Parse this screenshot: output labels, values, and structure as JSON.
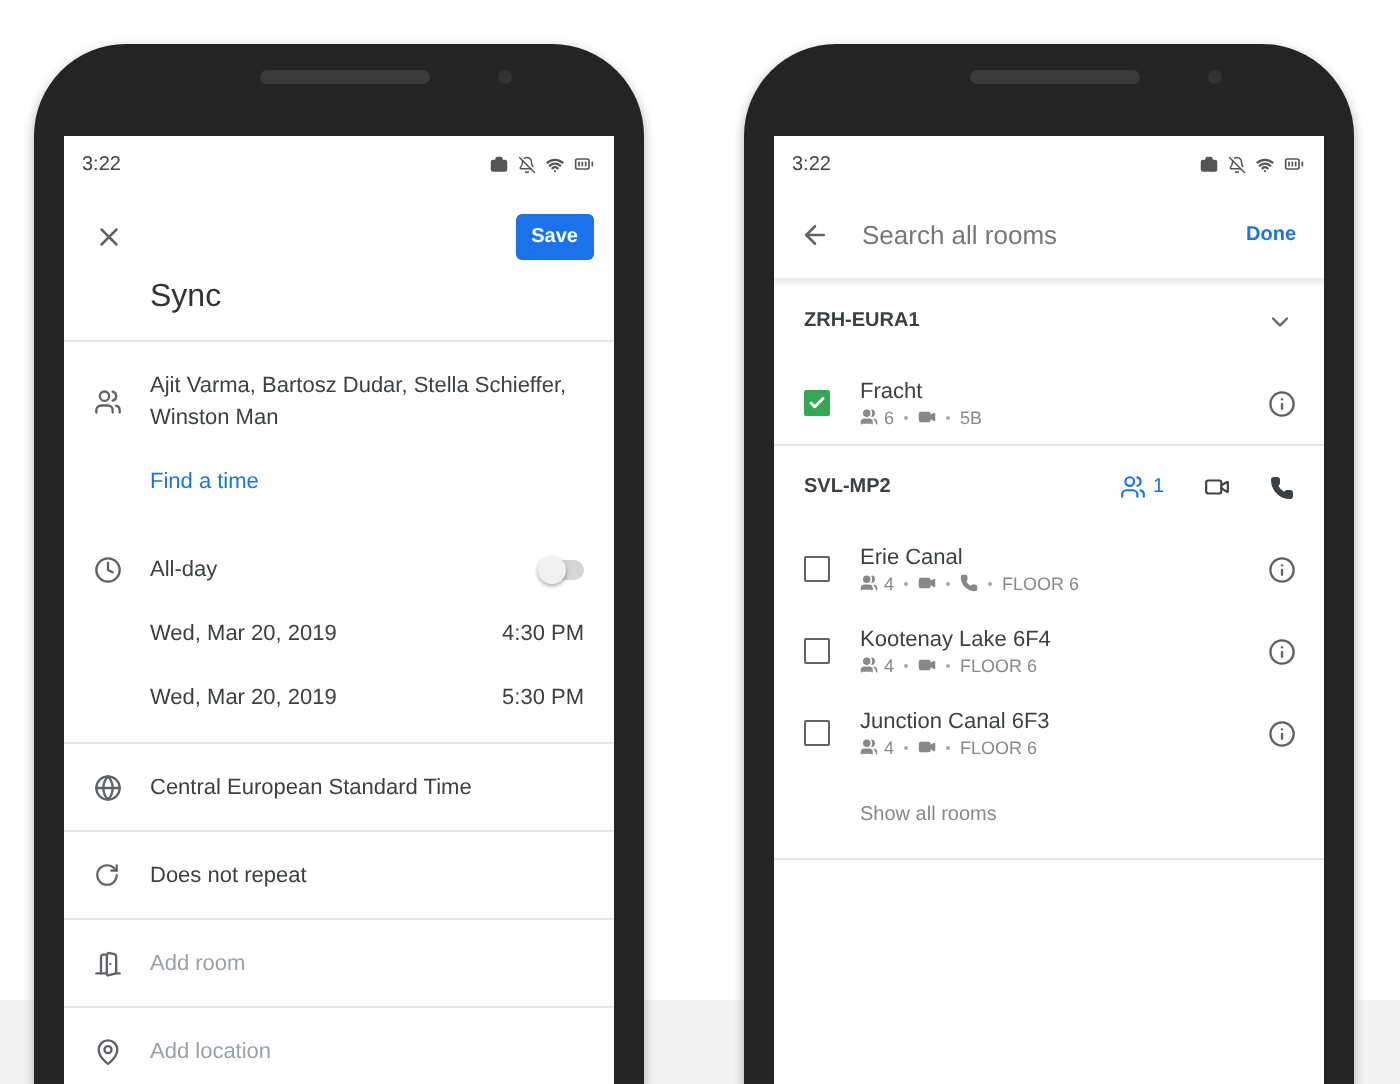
{
  "left_screen": {
    "status_time": "3:22",
    "save_label": "Save",
    "title": "Sync",
    "guests": "Ajit Varma, Bartosz Dudar, Stella Schieffer, Winston Man",
    "find_time": "Find a time",
    "all_day": {
      "label": "All-day",
      "on": false
    },
    "dates": [
      {
        "date": "Wed, Mar 20, 2019",
        "time": "4:30 PM"
      },
      {
        "date": "Wed, Mar 20, 2019",
        "time": "5:30 PM"
      }
    ],
    "rows": [
      {
        "kind": "timezone",
        "text": "Central European Standard Time",
        "hint": false
      },
      {
        "kind": "repeat",
        "text": "Does not repeat",
        "hint": false
      },
      {
        "kind": "room",
        "text": "Add room",
        "hint": true
      },
      {
        "kind": "location",
        "text": "Add location",
        "hint": true
      }
    ]
  },
  "right_screen": {
    "status_time": "3:22",
    "search": {
      "placeholder": "Search all rooms"
    },
    "done_label": "Done",
    "groups": [
      {
        "name": "ZRH-EURA1",
        "rooms": [
          {
            "name": "Fracht",
            "checked": true,
            "capacity": "6",
            "features": [
              {
                "kind": "video"
              }
            ],
            "location": "5B"
          }
        ]
      },
      {
        "name": "SVL-MP2",
        "show_all": "Show all rooms",
        "filters": [
          {
            "kind": "people",
            "count": "1",
            "selected": true
          },
          {
            "kind": "video",
            "selected": false
          },
          {
            "kind": "phone",
            "selected": false
          }
        ],
        "rooms": [
          {
            "name": "Erie Canal",
            "checked": false,
            "capacity": "4",
            "features": [
              {
                "kind": "video"
              },
              {
                "kind": "phone"
              }
            ],
            "location": "FLOOR 6"
          },
          {
            "name": "Kootenay Lake 6F4",
            "checked": false,
            "capacity": "4",
            "features": [
              {
                "kind": "video"
              }
            ],
            "location": "FLOOR 6"
          },
          {
            "name": "Junction Canal 6F3",
            "checked": false,
            "capacity": "4",
            "features": [
              {
                "kind": "video"
              }
            ],
            "location": "FLOOR 6"
          }
        ]
      }
    ]
  }
}
